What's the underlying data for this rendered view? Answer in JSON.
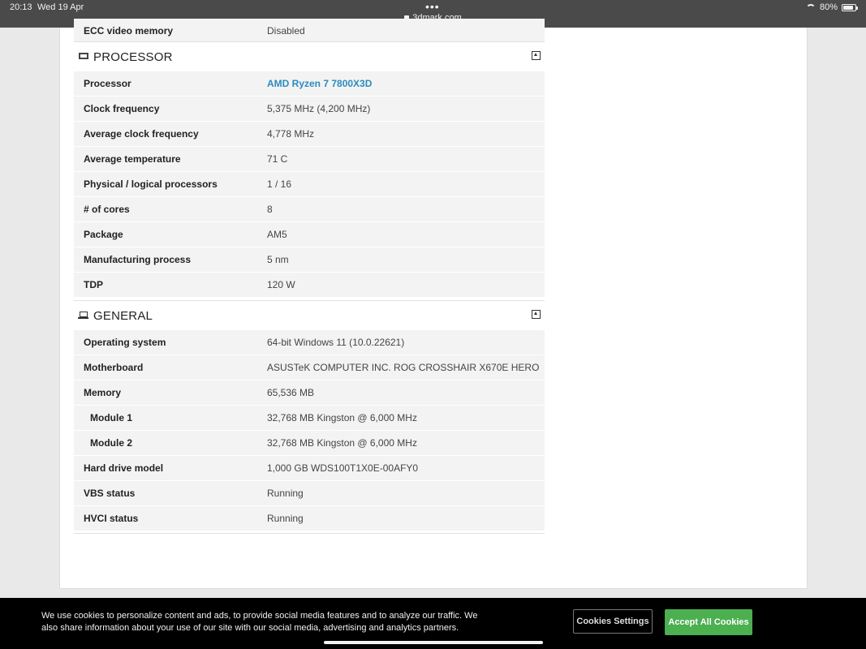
{
  "status_bar": {
    "time": "20:13",
    "date": "Wed 19 Apr",
    "url": "3dmark.com",
    "battery": "80%"
  },
  "top_partial_row": {
    "label": "ECC video memory",
    "value": "Disabled"
  },
  "processor_section": {
    "title": "PROCESSOR",
    "rows": [
      {
        "label": "Processor",
        "value": "AMD Ryzen 7 7800X3D"
      },
      {
        "label": "Clock frequency",
        "value": "5,375 MHz (4,200 MHz)"
      },
      {
        "label": "Average clock frequency",
        "value": "4,778 MHz"
      },
      {
        "label": "Average temperature",
        "value": "71 C"
      },
      {
        "label": "Physical / logical processors",
        "value": "1 / 16"
      },
      {
        "label": "# of cores",
        "value": "8"
      },
      {
        "label": "Package",
        "value": "AM5"
      },
      {
        "label": "Manufacturing process",
        "value": "5 nm"
      },
      {
        "label": "TDP",
        "value": "120 W"
      }
    ]
  },
  "general_section": {
    "title": "GENERAL",
    "rows": [
      {
        "label": "Operating system",
        "value": "64-bit Windows 11 (10.0.22621)"
      },
      {
        "label": "Motherboard",
        "value": "ASUSTeK COMPUTER INC. ROG CROSSHAIR X670E HERO"
      },
      {
        "label": "Memory",
        "value": "65,536 MB"
      },
      {
        "label": "Module 1",
        "value": "32,768 MB Kingston @ 6,000 MHz"
      },
      {
        "label": "Module 2",
        "value": "32,768 MB Kingston @ 6,000 MHz"
      },
      {
        "label": "Hard drive model",
        "value": "1,000 GB WDS100T1X0E-00AFY0"
      },
      {
        "label": "VBS status",
        "value": "Running"
      },
      {
        "label": "HVCI status",
        "value": "Running"
      }
    ]
  },
  "cookie_banner": {
    "text": "We use cookies to personalize content and ads, to provide social media features and to analyze our traffic. We also share information about your use of our site with our social media, advertising and analytics partners.",
    "settings_label": "Cookies Settings",
    "accept_label": "Accept All Cookies"
  },
  "colors": {
    "link": "#2b8cbe",
    "accept_button": "#4caf50",
    "status_bar": "#4a4a4a"
  }
}
